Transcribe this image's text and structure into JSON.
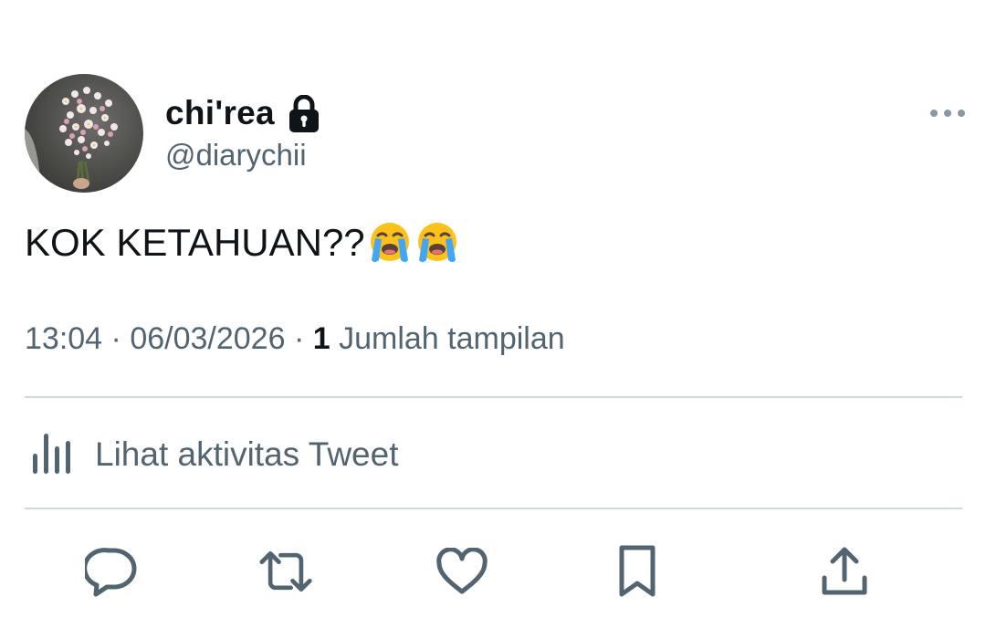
{
  "tweet": {
    "author": {
      "display_name": "chi'rea",
      "handle": "@diarychii",
      "protected_icon": "lock-icon",
      "avatar_icon": "flower-bouquet-avatar"
    },
    "text": "KOK KETAHUAN??",
    "emojis": [
      "loudly-crying-face",
      "loudly-crying-face"
    ],
    "time": "13:04",
    "date": "06/03/2026",
    "separator": "·",
    "view_count": "1",
    "view_label": "Jumlah tampilan",
    "more_icon": "more-horizontal-icon"
  },
  "activity": {
    "icon": "analytics-bars-icon",
    "label": "Lihat aktivitas Tweet"
  },
  "actions": [
    {
      "name": "reply",
      "icon": "reply-bubble-icon"
    },
    {
      "name": "retweet",
      "icon": "retweet-icon"
    },
    {
      "name": "like",
      "icon": "heart-icon"
    },
    {
      "name": "bookmark",
      "icon": "bookmark-icon"
    },
    {
      "name": "share",
      "icon": "share-upload-icon"
    }
  ],
  "colors": {
    "text_primary": "#0f1419",
    "text_secondary": "#536471",
    "divider": "#cfd9de",
    "background": "#ffffff"
  }
}
